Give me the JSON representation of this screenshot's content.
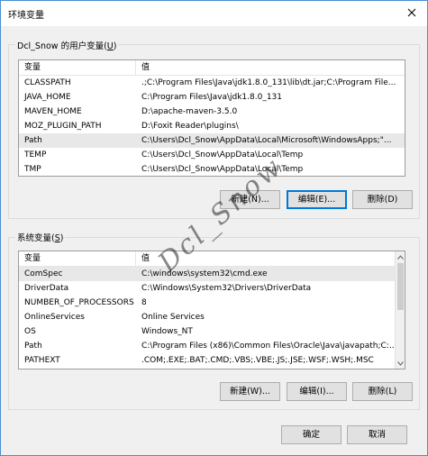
{
  "window": {
    "title": "环境变量"
  },
  "user_vars": {
    "group_label_prefix": "Dcl_Snow 的用户变量(",
    "group_label_key": "U",
    "group_label_suffix": ")",
    "columns": [
      "变量",
      "值"
    ],
    "rows": [
      {
        "name": "CLASSPATH",
        "value": ".;C:\\Program Files\\Java\\jdk1.8.0_131\\lib\\dt.jar;C:\\Program File..."
      },
      {
        "name": "JAVA_HOME",
        "value": "C:\\Program Files\\Java\\jdk1.8.0_131"
      },
      {
        "name": "MAVEN_HOME",
        "value": "D:\\apache-maven-3.5.0"
      },
      {
        "name": "MOZ_PLUGIN_PATH",
        "value": "D:\\Foxit Reader\\plugins\\"
      },
      {
        "name": "Path",
        "value": "C:\\Users\\Dcl_Snow\\AppData\\Local\\Microsoft\\WindowsApps;\"..."
      },
      {
        "name": "TEMP",
        "value": "C:\\Users\\Dcl_Snow\\AppData\\Local\\Temp"
      },
      {
        "name": "TMP",
        "value": "C:\\Users\\Dcl_Snow\\AppData\\Local\\Temp"
      }
    ],
    "selected_row": "Path",
    "buttons": {
      "new": "新建(N)...",
      "edit": "编辑(E)...",
      "delete": "删除(D)"
    }
  },
  "system_vars": {
    "group_label_prefix": "系统变量(",
    "group_label_key": "S",
    "group_label_suffix": ")",
    "columns": [
      "变量",
      "值"
    ],
    "rows": [
      {
        "name": "ComSpec",
        "value": "C:\\windows\\system32\\cmd.exe"
      },
      {
        "name": "DriverData",
        "value": "C:\\Windows\\System32\\Drivers\\DriverData"
      },
      {
        "name": "NUMBER_OF_PROCESSORS",
        "value": "8"
      },
      {
        "name": "OnlineServices",
        "value": "Online Services"
      },
      {
        "name": "OS",
        "value": "Windows_NT"
      },
      {
        "name": "Path",
        "value": "C:\\Program Files (x86)\\Common Files\\Oracle\\Java\\javapath;C:..."
      },
      {
        "name": "PATHEXT",
        "value": ".COM;.EXE;.BAT;.CMD;.VBS;.VBE;.JS;.JSE;.WSF;.WSH;.MSC"
      }
    ],
    "selected_row": "ComSpec",
    "buttons": {
      "new": "新建(W)...",
      "edit": "编辑(I)...",
      "delete": "删除(L)"
    }
  },
  "dialog_buttons": {
    "ok": "确定",
    "cancel": "取消"
  },
  "watermark": "Dcl_Snow",
  "icons": {
    "close": "close-icon",
    "scroll_up": "chevron-up-icon",
    "scroll_down": "chevron-down-icon"
  }
}
